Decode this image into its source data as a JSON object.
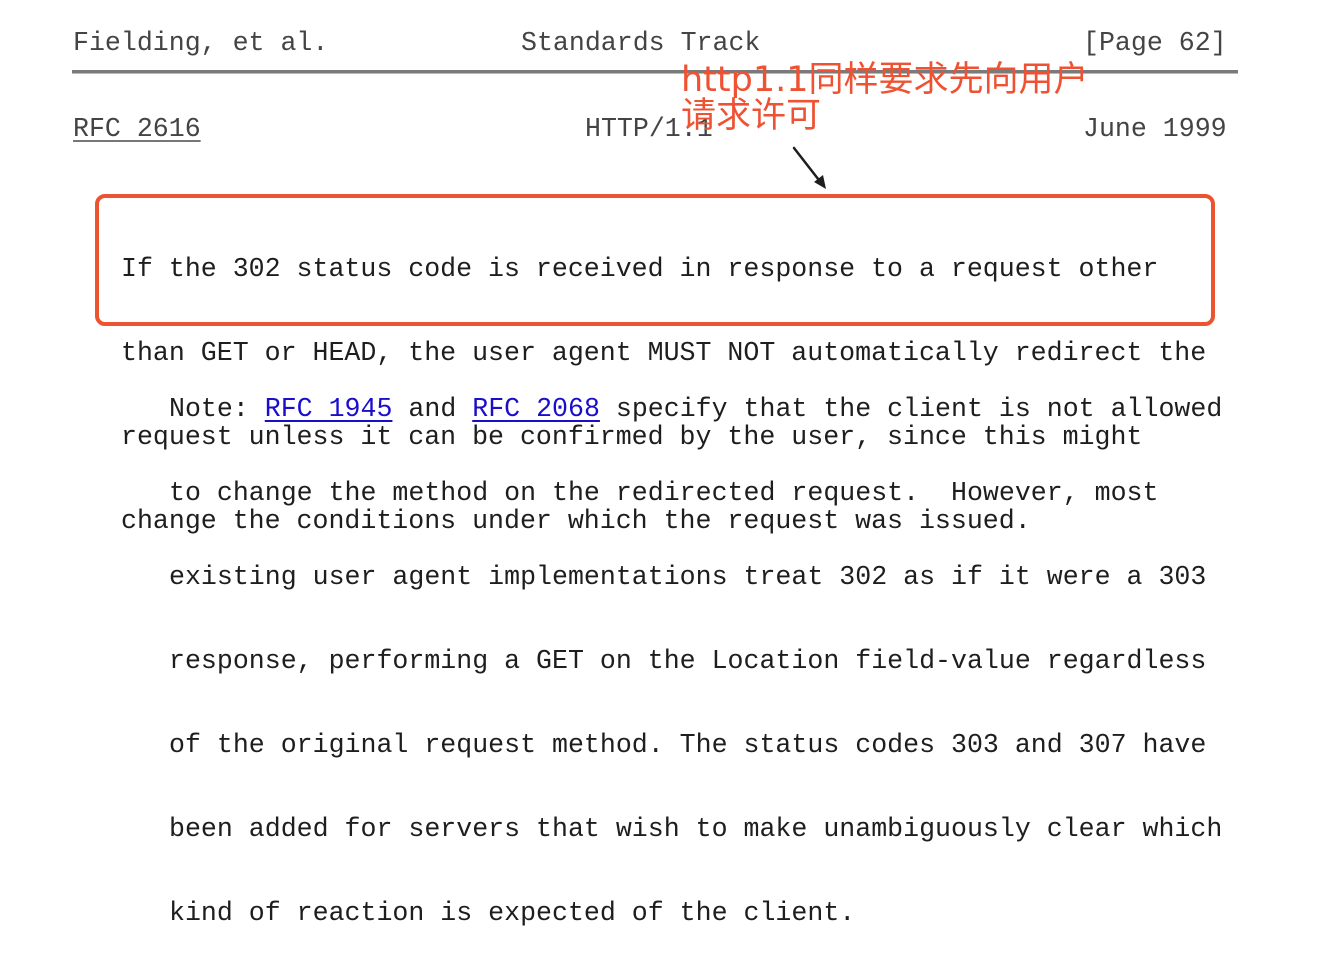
{
  "page_footer": {
    "authors": "Fielding, et al.",
    "category": "Standards Track",
    "page_number": "[Page 62]"
  },
  "page_header": {
    "rfc": "RFC 2616",
    "protocol": "HTTP/1.1",
    "date": "June 1999"
  },
  "annotation": {
    "line1": "http1.1同样要求先向用户",
    "line2": "请求许可",
    "color": "#ee5233"
  },
  "highlighted_paragraph": {
    "lines": [
      "If the 302 status code is received in response to a request other",
      "than GET or HEAD, the user agent MUST NOT automatically redirect the",
      "request unless it can be confirmed by the user, since this might",
      "change the conditions under which the request was issued."
    ]
  },
  "note_paragraph": {
    "prefix": "Note: ",
    "link1": "RFC 1945",
    "between": " and ",
    "link2": "RFC 2068",
    "line1_rest": " specify that the client is not allowed",
    "lines": [
      "to change the method on the redirected request.  However, most",
      "existing user agent implementations treat 302 as if it were a 303",
      "response, performing a GET on the Location field-value regardless",
      "of the original request method. The status codes 303 and 307 have",
      "been added for servers that wish to make unambiguously clear which",
      "kind of reaction is expected of the client."
    ]
  },
  "colors": {
    "highlight": "#ec5331",
    "link": "#1a0dcc"
  }
}
